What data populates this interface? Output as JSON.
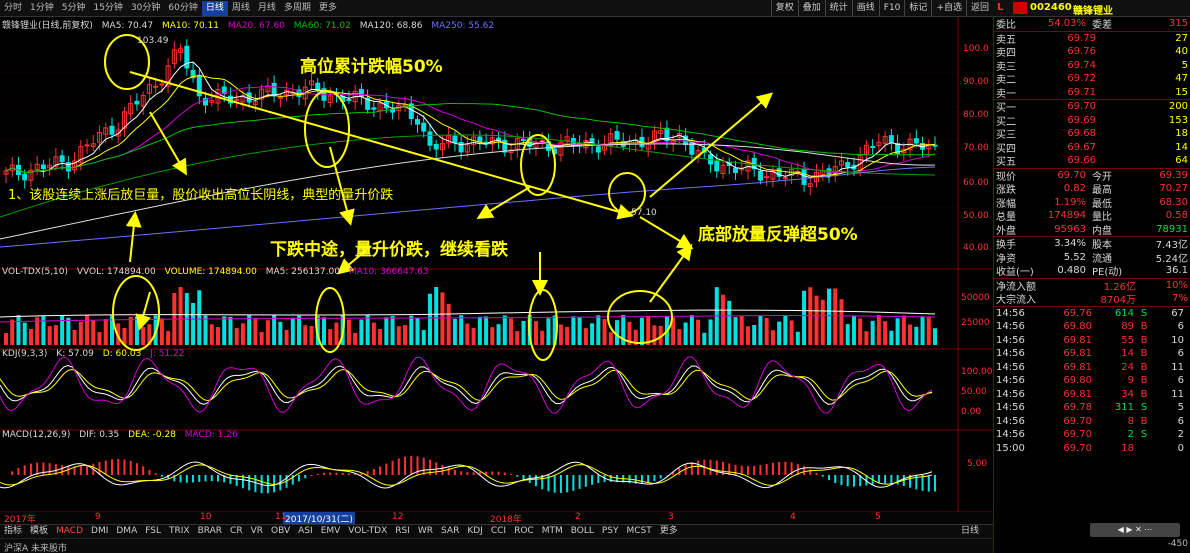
{
  "toolbar": {
    "timeframes": [
      "分时",
      "1分钟",
      "5分钟",
      "15分钟",
      "30分钟",
      "60分钟",
      "日线",
      "周线",
      "月线",
      "多周期",
      "更多"
    ],
    "active_index": 6,
    "right_buttons": [
      "复权",
      "叠加",
      "统计",
      "画线",
      "F10",
      "标记",
      "+自选",
      "返回"
    ]
  },
  "stock": {
    "code_prefix": "L",
    "code": "002460",
    "name": "赣锋锂业"
  },
  "main_info": {
    "title": "赣锋锂业(日线,前复权)",
    "ma5": "MA5: 70.47",
    "ma10": "MA10: 70.11",
    "ma20": "MA20: 67.60",
    "ma60": "MA60: 71.02",
    "ma120": "MA120: 68.86",
    "ma250": "MA250: 55.62"
  },
  "price_axis": [
    "100.0",
    "90.00",
    "80.00",
    "70.00",
    "60.00",
    "50.00",
    "40.00"
  ],
  "peak_label": "103.49",
  "low_label": "57.10",
  "volume_info": {
    "title": "VOL-TDX(5,10)",
    "vvol": "VVOL: 174894.00",
    "volume": "VOLUME: 174894.00",
    "ma5": "MA5: 256137.00",
    "ma10": "MA10: 366647.63"
  },
  "volume_axis": [
    "50000",
    "25000"
  ],
  "kdj_info": {
    "title": "KDJ(9,3,3)",
    "k": "K: 57.09",
    "d": "D: 60.03",
    "j": "J: 51.22"
  },
  "kdj_axis": [
    "100.00",
    "50.00",
    "0.00"
  ],
  "macd_info": {
    "title": "MACD(12,26,9)",
    "dif": "DIF: 0.35",
    "dea": "DEA: -0.28",
    "macd": "MACD: 1.26"
  },
  "macd_axis": [
    "5.00"
  ],
  "dates": [
    "2017年",
    "9",
    "10",
    "11",
    "12",
    "2018年",
    "2",
    "3",
    "4",
    "5"
  ],
  "date_highlight": "2017/10/31(二)",
  "bottom_tabs": [
    "指标",
    "模板",
    "MACD",
    "DMI",
    "DMA",
    "FSL",
    "TRIX",
    "BRAR",
    "CR",
    "VR",
    "OBV",
    "ASI",
    "EMV",
    "VOL-TDX",
    "RSI",
    "WR",
    "SAR",
    "KDJ",
    "CCI",
    "ROC",
    "MTM",
    "BOLL",
    "PSY",
    "MCST",
    "更多"
  ],
  "bottom_tabs_active": "MACD",
  "bottom_right": "日线",
  "annotations": {
    "top": "高位累计跌幅50%",
    "note1": "1、该股连续上涨后放巨量，股价收出高位长阴线，典型的量升价跌",
    "mid": "下跌中途，量升价跌，继续看跌",
    "bottom": "底部放量反弹超50%"
  },
  "order_book": {
    "ratio": {
      "label1": "委比",
      "val1": "54.03%",
      "label2": "委差",
      "val2": "315"
    },
    "asks": [
      {
        "label": "卖五",
        "price": "69.79",
        "vol": "27"
      },
      {
        "label": "卖四",
        "price": "69.76",
        "vol": "40"
      },
      {
        "label": "卖三",
        "price": "69.74",
        "vol": "5"
      },
      {
        "label": "卖二",
        "price": "69.72",
        "vol": "47"
      },
      {
        "label": "卖一",
        "price": "69.71",
        "vol": "15"
      }
    ],
    "bids": [
      {
        "label": "买一",
        "price": "69.70",
        "vol": "200"
      },
      {
        "label": "买二",
        "price": "69.69",
        "vol": "153"
      },
      {
        "label": "买三",
        "price": "69.68",
        "vol": "18"
      },
      {
        "label": "买四",
        "price": "69.67",
        "vol": "14"
      },
      {
        "label": "买五",
        "price": "69.66",
        "vol": "64"
      }
    ]
  },
  "quote": [
    {
      "l1": "现价",
      "v1": "69.70",
      "l2": "今开",
      "v2": "69.39"
    },
    {
      "l1": "涨跌",
      "v1": "0.82",
      "l2": "最高",
      "v2": "70.27"
    },
    {
      "l1": "涨幅",
      "v1": "1.19%",
      "l2": "最低",
      "v2": "68.30"
    },
    {
      "l1": "总量",
      "v1": "174894",
      "l2": "量比",
      "v2": "0.58"
    },
    {
      "l1": "外盘",
      "v1": "95963",
      "l2": "内盘",
      "v2": "78931"
    }
  ],
  "fundamentals": [
    {
      "l1": "换手",
      "v1": "3.34%",
      "l2": "股本",
      "v2": "7.43亿"
    },
    {
      "l1": "净资",
      "v1": "5.52",
      "l2": "流通",
      "v2": "5.24亿"
    },
    {
      "l1": "收益(一)",
      "v1": "0.480",
      "l2": "PE(动)",
      "v2": "36.1"
    }
  ],
  "flows": [
    {
      "l": "净流入额",
      "v1": "1.26亿",
      "v2": "10%"
    },
    {
      "l": "大宗流入",
      "v1": "8704万",
      "v2": "7%"
    }
  ],
  "ticks": [
    {
      "t": "14:56",
      "p": "69.76",
      "v": "614",
      "s": "S",
      "n": "67"
    },
    {
      "t": "14:56",
      "p": "69.80",
      "v": "89",
      "s": "B",
      "n": "6"
    },
    {
      "t": "14:56",
      "p": "69.81",
      "v": "55",
      "s": "B",
      "n": "10"
    },
    {
      "t": "14:56",
      "p": "69.81",
      "v": "14",
      "s": "B",
      "n": "6"
    },
    {
      "t": "14:56",
      "p": "69.81",
      "v": "24",
      "s": "B",
      "n": "11"
    },
    {
      "t": "14:56",
      "p": "69.80",
      "v": "9",
      "s": "B",
      "n": "6"
    },
    {
      "t": "14:56",
      "p": "69.81",
      "v": "34",
      "s": "B",
      "n": "11"
    },
    {
      "t": "14:56",
      "p": "69.78",
      "v": "311",
      "s": "S",
      "n": "5"
    },
    {
      "t": "14:56",
      "p": "69.70",
      "v": "8",
      "s": "B",
      "n": "6"
    },
    {
      "t": "14:56",
      "p": "69.70",
      "v": "2",
      "s": "S",
      "n": "2"
    },
    {
      "t": "15:00",
      "p": "69.70",
      "v": "18",
      "s": "",
      "n": "0"
    }
  ],
  "status": {
    "left": "沪深A 未来股市",
    "right": "-450"
  },
  "colors": {
    "up": "#ff3030",
    "down": "#00e0e0",
    "ma5": "#ffffff",
    "ma10": "#ffff00",
    "ma20": "#d000d0",
    "ma60": "#00c000",
    "ma120": "#7070ff",
    "annotation": "#ffff00"
  }
}
